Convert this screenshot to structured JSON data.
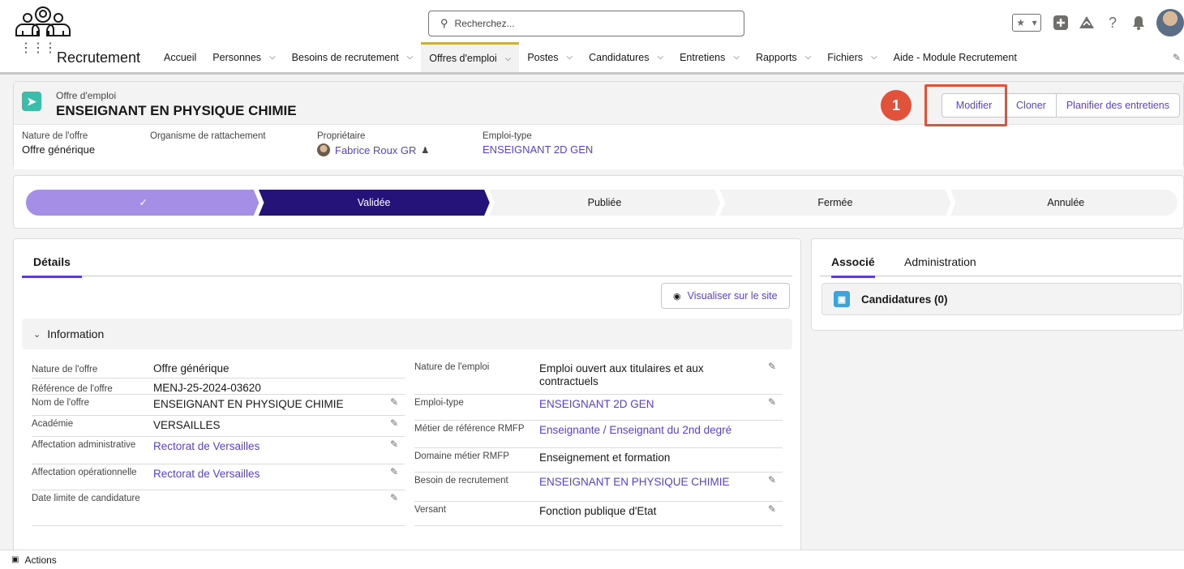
{
  "search": {
    "placeholder": "Recherchez..."
  },
  "app": {
    "name": "Recrutement"
  },
  "nav": [
    {
      "label": "Accueil",
      "dropdown": false
    },
    {
      "label": "Personnes",
      "dropdown": true
    },
    {
      "label": "Besoins de recrutement",
      "dropdown": true
    },
    {
      "label": "Offres d'emploi",
      "dropdown": true,
      "active": true
    },
    {
      "label": "Postes",
      "dropdown": true
    },
    {
      "label": "Candidatures",
      "dropdown": true
    },
    {
      "label": "Entretiens",
      "dropdown": true
    },
    {
      "label": "Rapports",
      "dropdown": true
    },
    {
      "label": "Fichiers",
      "dropdown": true
    },
    {
      "label": "Aide - Module Recrutement",
      "dropdown": false
    }
  ],
  "record": {
    "type": "Offre d'emploi",
    "title": "ENSEIGNANT EN PHYSIQUE CHIMIE",
    "actions": {
      "modifier": "Modifier",
      "cloner": "Cloner",
      "planifier": "Planifier des entretiens"
    },
    "step_badge": "1",
    "highlights": {
      "nature_label": "Nature de l'offre",
      "nature_value": "Offre générique",
      "organisme_label": "Organisme de rattachement",
      "proprietaire_label": "Propriétaire",
      "proprietaire_value": "Fabrice Roux GR",
      "emploi_label": "Emploi-type",
      "emploi_value": "ENSEIGNANT 2D GEN"
    }
  },
  "path": {
    "done_mark": "✓",
    "stages": [
      "Validée",
      "Publiée",
      "Fermée",
      "Annulée"
    ],
    "colors": {
      "done": "#a58ee6",
      "current": "#26137a",
      "todo": "#f3f3f3"
    }
  },
  "details": {
    "tab": "Détails",
    "visualiser": "Visualiser sur le site",
    "section": "Information",
    "left": [
      {
        "label": "Nature de l'offre",
        "value": "Offre générique",
        "link": false,
        "edit": false
      },
      {
        "label": "Référence de l'offre",
        "value": "MENJ-25-2024-03620",
        "link": false,
        "edit": false
      },
      {
        "label": "Nom de l'offre",
        "value": "ENSEIGNANT EN PHYSIQUE CHIMIE",
        "link": false,
        "edit": true
      },
      {
        "label": "Académie",
        "value": "VERSAILLES",
        "link": false,
        "edit": true
      },
      {
        "label": "Affectation administrative",
        "value": "Rectorat de Versailles",
        "link": true,
        "edit": true
      },
      {
        "label": "Affectation opérationnelle",
        "value": "Rectorat de Versailles",
        "link": true,
        "edit": true
      },
      {
        "label": "Date limite de candidature",
        "value": "",
        "link": false,
        "edit": true
      }
    ],
    "right": [
      {
        "label": "Nature de l'emploi",
        "value": "Emploi ouvert aux titulaires et aux contractuels",
        "link": false,
        "edit": true
      },
      {
        "label": "Emploi-type",
        "value": "ENSEIGNANT 2D GEN",
        "link": true,
        "edit": true
      },
      {
        "label": "Métier de référence RMFP",
        "value": "Enseignante / Enseignant du 2nd degré",
        "link": true,
        "edit": false
      },
      {
        "label": "Domaine métier RMFP",
        "value": "Enseignement et formation",
        "link": false,
        "edit": false
      },
      {
        "label": "Besoin de recrutement",
        "value": "ENSEIGNANT EN PHYSIQUE CHIMIE",
        "link": true,
        "edit": true
      },
      {
        "label": "Versant",
        "value": "Fonction publique d'Etat",
        "link": false,
        "edit": true
      }
    ]
  },
  "related": {
    "tabs": [
      "Associé",
      "Administration"
    ],
    "list": "Candidatures (0)"
  },
  "footer": {
    "label": "Actions"
  }
}
